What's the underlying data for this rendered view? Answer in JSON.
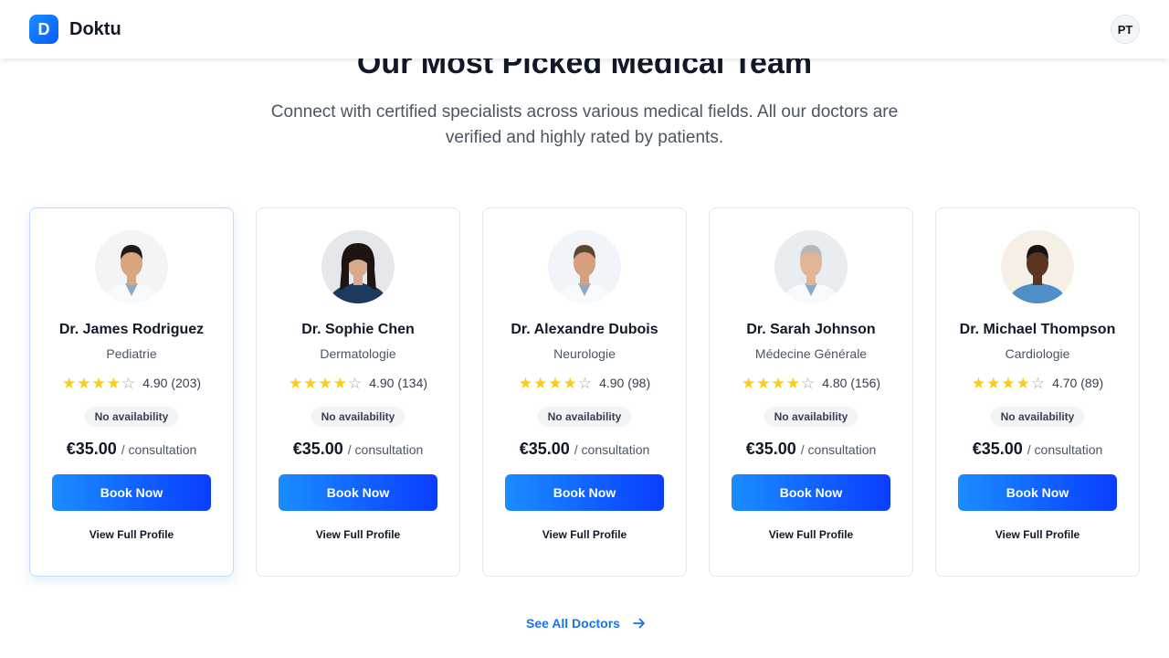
{
  "header": {
    "logo_letter": "D",
    "brand_name": "Doktu",
    "user_initials": "PT"
  },
  "section": {
    "title": "Our Most Picked Medical Team",
    "subtitle": "Connect with certified specialists across various medical fields. All our doctors are verified and highly rated by patients."
  },
  "doctors": [
    {
      "name": "Dr. James Rodriguez",
      "specialty": "Pediatrie",
      "stars": 4,
      "rating": "4.90 (203)",
      "availability": "No availability",
      "price": "€35.00",
      "price_unit": "/ consultation",
      "book_label": "Book Now",
      "profile_label": "View Full Profile",
      "gender": "male",
      "skin": "#d9a57c",
      "hair": "#1e1b18",
      "attire": "white-coat",
      "bg": "#f3f4f6"
    },
    {
      "name": "Dr. Sophie Chen",
      "specialty": "Dermatologie",
      "stars": 4,
      "rating": "4.90 (134)",
      "availability": "No availability",
      "price": "€35.00",
      "price_unit": "/ consultation",
      "book_label": "Book Now",
      "profile_label": "View Full Profile",
      "gender": "female",
      "skin": "#d8a98a",
      "hair": "#1c1512",
      "attire": "navy-scrubs",
      "bg": "#e5e7eb"
    },
    {
      "name": "Dr. Alexandre Dubois",
      "specialty": "Neurologie",
      "stars": 4,
      "rating": "4.90 (98)",
      "availability": "No availability",
      "price": "€35.00",
      "price_unit": "/ consultation",
      "book_label": "Book Now",
      "profile_label": "View Full Profile",
      "gender": "male",
      "skin": "#d6a07f",
      "hair": "#5b4636",
      "attire": "white-coat",
      "bg": "#f1f5f9"
    },
    {
      "name": "Dr. Sarah Johnson",
      "specialty": "Médecine Générale",
      "stars": 4,
      "rating": "4.80 (156)",
      "availability": "No availability",
      "price": "€35.00",
      "price_unit": "/ consultation",
      "book_label": "Book Now",
      "profile_label": "View Full Profile",
      "gender": "male",
      "skin": "#e3b596",
      "hair": "#b8b8b8",
      "attire": "white-coat",
      "bg": "#e8edf2"
    },
    {
      "name": "Dr. Michael Thompson",
      "specialty": "Cardiologie",
      "stars": 4,
      "rating": "4.70 (89)",
      "availability": "No availability",
      "price": "€35.00",
      "price_unit": "/ consultation",
      "book_label": "Book Now",
      "profile_label": "View Full Profile",
      "gender": "male",
      "skin": "#5a3622",
      "hair": "#1a1210",
      "attire": "blue-scrubs",
      "bg": "#f5efe6"
    }
  ],
  "footer_link": {
    "label": "See All Doctors"
  },
  "colors": {
    "accent": "#1a8dff",
    "accent_dark": "#0a3dff",
    "star": "#facc15",
    "link": "#1a73e8"
  }
}
